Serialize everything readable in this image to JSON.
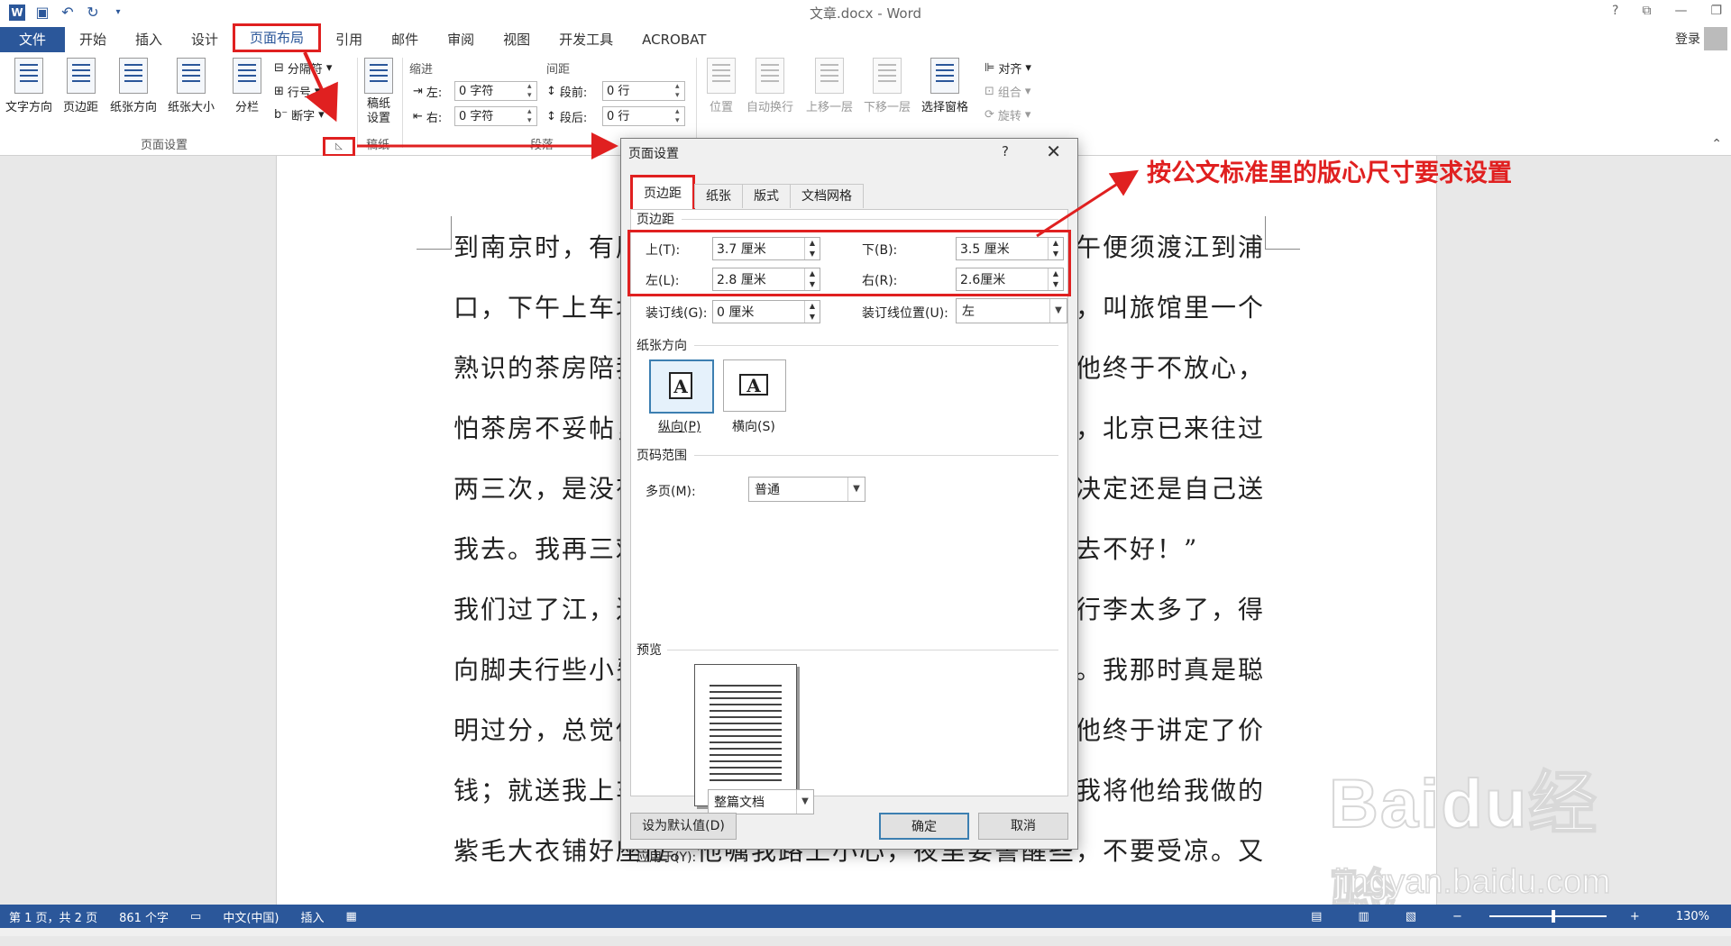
{
  "window": {
    "title": "文章.docx - Word",
    "controls": [
      "?",
      "⧉",
      "—",
      "❐"
    ]
  },
  "tabs": [
    {
      "label": "文件"
    },
    {
      "label": "开始"
    },
    {
      "label": "插入"
    },
    {
      "label": "设计"
    },
    {
      "label": "页面布局"
    },
    {
      "label": "引用"
    },
    {
      "label": "邮件"
    },
    {
      "label": "审阅"
    },
    {
      "label": "视图"
    },
    {
      "label": "开发工具"
    },
    {
      "label": "ACROBAT"
    }
  ],
  "account": {
    "login": "登录"
  },
  "ribbon": {
    "page_setup": {
      "text_direction": "文字方向",
      "margins": "页边距",
      "orientation": "纸张方向",
      "size": "纸张大小",
      "columns": "分栏",
      "breaks": "分隔符",
      "line_numbers": "行号",
      "hyphenation": "断字",
      "group_label": "页面设置"
    },
    "draft": {
      "label": "稿纸\n设置",
      "group_label": "稿纸"
    },
    "paragraph": {
      "indent_header": "缩进",
      "spacing_header": "间距",
      "left_label": "左:",
      "left_value": "0 字符",
      "right_label": "右:",
      "right_value": "0 字符",
      "before_label": "段前:",
      "before_value": "0 行",
      "after_label": "段后:",
      "after_value": "0 行",
      "group_label": "段落"
    },
    "arrange": {
      "position": "位置",
      "wrap": "自动换行",
      "forward": "上移一层",
      "backward": "下移一层",
      "selection_pane": "选择窗格",
      "align": "对齐",
      "group": "组合",
      "rotate": "旋转"
    }
  },
  "document": {
    "lines": [
      "到南京时，有朋",
      "口，下午上车北",
      "熟识的茶房陪我",
      "怕茶房不妥帖，",
      "两三次，是没有",
      "我去。我再三劝",
      "我们过了江，进",
      "向脚夫行些小费",
      "明过分，总觉他",
      "钱；就送我上车",
      "紫毛大衣铺好座位。他嘱我路上小心，夜里要警醒些，不要受凉。又"
    ],
    "right_fragments": [
      "午便须渡江到浦",
      "，叫旅馆里一个",
      "他终于不放心，",
      "，北京已来往过",
      "决定还是自己送",
      "去不好！”",
      "行李太多了，得",
      "。我那时真是聪",
      "他终于讲定了价",
      "我将他给我做的"
    ]
  },
  "dialog": {
    "title": "页面设置",
    "help": "?",
    "close": "✕",
    "tabs": [
      "页边距",
      "纸张",
      "版式",
      "文档网格"
    ],
    "margins_section": "页边距",
    "top_label": "上(T):",
    "top_value": "3.7 厘米",
    "bottom_label": "下(B):",
    "bottom_value": "3.5 厘米",
    "left_label": "左(L):",
    "left_value": "2.8 厘米",
    "right_label": "右(R):",
    "right_value": "2.6厘米",
    "gutter_label": "装订线(G):",
    "gutter_value": "0 厘米",
    "gutter_pos_label": "装订线位置(U):",
    "gutter_pos_value": "左",
    "orientation_section": "纸张方向",
    "portrait": "纵向(P)",
    "landscape": "横向(S)",
    "pages_section": "页码范围",
    "multiple_pages_label": "多页(M):",
    "multiple_pages_value": "普通",
    "preview_section": "预览",
    "apply_to_label": "应用于(Y):",
    "apply_to_value": "整篇文档",
    "set_default": "设为默认值(D)",
    "ok": "确定",
    "cancel": "取消"
  },
  "statusbar": {
    "page": "第 1 页，共 2 页",
    "words": "861 个字",
    "language": "中文(中国)",
    "mode": "插入",
    "zoom": "130%",
    "zoom_level_fraction": 0.55
  },
  "annotation": {
    "text": "按公文标准里的版心尺寸要求设置",
    "color": "#e02020"
  },
  "watermark": {
    "brand": "Baidu经验",
    "url": "jingyan.baidu.com"
  }
}
